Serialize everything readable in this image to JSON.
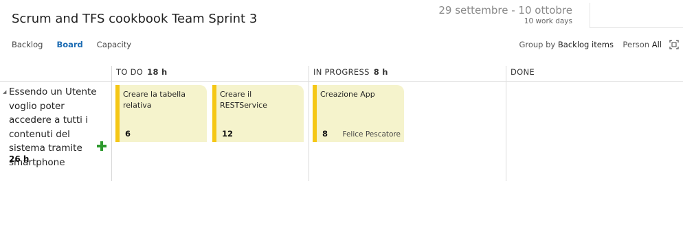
{
  "header": {
    "title": "Scrum and TFS cookbook Team Sprint 3",
    "dates": "29 settembre - 10 ottobre",
    "work_days": "10 work days"
  },
  "tabs": [
    {
      "label": "Backlog",
      "active": false
    },
    {
      "label": "Board",
      "active": true
    },
    {
      "label": "Capacity",
      "active": false
    }
  ],
  "toolbar": {
    "group_by_label": "Group by",
    "group_by_value": "Backlog items",
    "person_label": "Person",
    "person_value": "All",
    "fullscreen_icon": "fullscreen-icon"
  },
  "columns": [
    {
      "name": "TO DO",
      "hours": "18 h"
    },
    {
      "name": "IN PROGRESS",
      "hours": "8 h"
    },
    {
      "name": "DONE",
      "hours": ""
    }
  ],
  "row": {
    "title": "Essendo un Utente voglio poter accedere a tutti i contenuti del sistema tramite smartphone",
    "hours": "26 h",
    "add_icon": "plus-icon",
    "expand_icon": "triangle-collapse-icon"
  },
  "cards": [
    {
      "title": "Creare la tabella relativa",
      "remaining": "6",
      "owner": ""
    },
    {
      "title": "Creare il RESTService",
      "remaining": "12",
      "owner": ""
    },
    {
      "title": "Creazione App",
      "remaining": "8",
      "owner": "Felice Pescatore"
    }
  ],
  "colors": {
    "accent": "#1b6bb3",
    "card_bg": "#f5f3cc",
    "card_border": "#f5c716",
    "add_green": "#2e9a2e"
  }
}
